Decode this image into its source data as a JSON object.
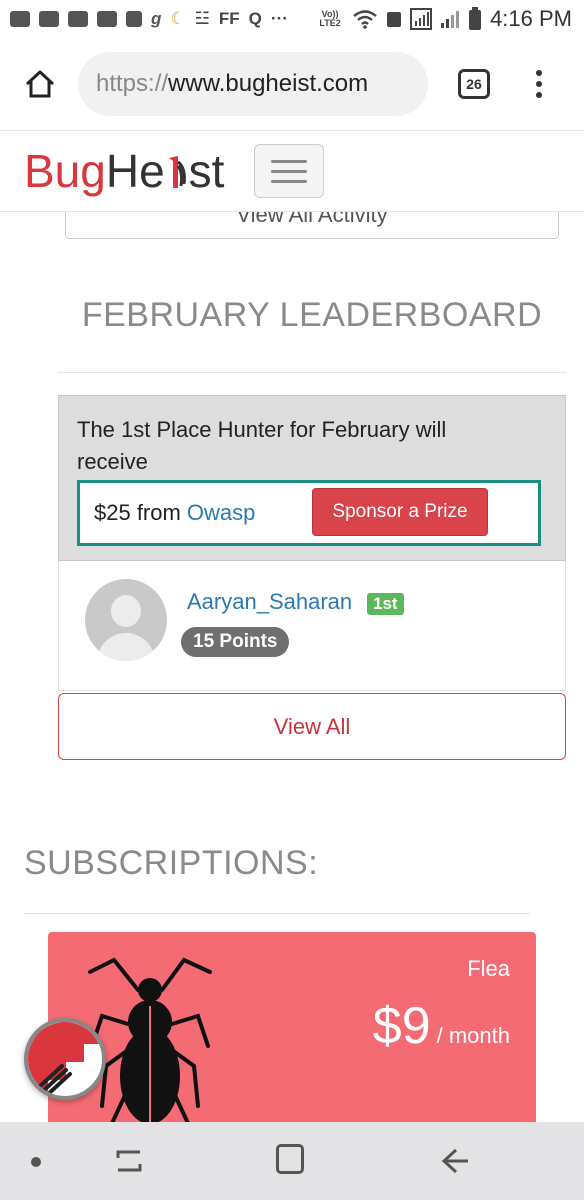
{
  "status_bar": {
    "text_icons": [
      "FF",
      "Q",
      "···"
    ],
    "network_label": "Vo)) LTE2",
    "clock": "4:16 PM"
  },
  "browser": {
    "url_scheme": "https://",
    "url_host": "www.bugheist.com",
    "tab_count": "26"
  },
  "site_header": {
    "logo_bug": "Bug",
    "logo_he": "He",
    "logo_st": "st"
  },
  "activity": {
    "view_all_label": "View All Activity"
  },
  "leaderboard": {
    "title": "FEBRUARY LEADERBOARD",
    "prize_text": "The 1st Place Hunter for February will receive",
    "prize_amount": "$25 from",
    "prize_sponsor": "Owasp",
    "sponsor_button": "Sponsor a Prize",
    "winner": {
      "name": "Aaryan_Saharan",
      "rank": "1st",
      "points": "15 Points"
    },
    "view_all_label": "View All"
  },
  "subscriptions": {
    "title": "SUBSCRIPTIONS:",
    "plan": {
      "name": "Flea",
      "price": "$9",
      "period": "/ month",
      "color": "#f46b74"
    }
  },
  "colors": {
    "brand_red": "#d9363e",
    "link_blue": "#2a7ab0",
    "highlight_teal": "#1a8f7f",
    "badge_green": "#5cb85c"
  }
}
